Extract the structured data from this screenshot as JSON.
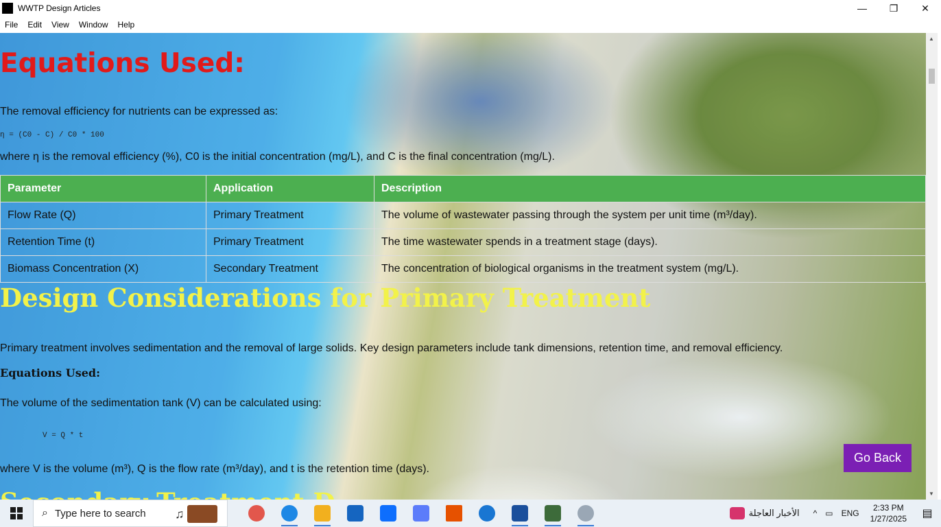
{
  "window": {
    "title": "WWTP Design Articles",
    "controls": {
      "minimize": "—",
      "maximize": "❐",
      "close": "✕"
    }
  },
  "menu": [
    "File",
    "Edit",
    "View",
    "Window",
    "Help"
  ],
  "article": {
    "equations_heading": "Equations Used:",
    "nutrient_intro": "The removal efficiency for nutrients can be expressed as:",
    "nutrient_equation": "η = (C0 - C) / C0 * 100",
    "nutrient_where": "where η is the removal efficiency (%), C0 is the initial concentration (mg/L), and C is the final concentration (mg/L).",
    "table": {
      "headers": [
        "Parameter",
        "Application",
        "Description"
      ],
      "rows": [
        [
          "Flow Rate (Q)",
          "Primary Treatment",
          "The volume of wastewater passing through the system per unit time (m³/day)."
        ],
        [
          "Retention Time (t)",
          "Primary Treatment",
          "The time wastewater spends in a treatment stage (days)."
        ],
        [
          "Biomass Concentration (X)",
          "Secondary Treatment",
          "The concentration of biological organisms in the treatment system (mg/L)."
        ]
      ]
    },
    "primary_heading": "Design Considerations for Primary Treatment",
    "primary_intro": "Primary treatment involves sedimentation and the removal of large solids. Key design parameters include tank dimensions, retention time, and removal efficiency.",
    "primary_eq_heading": "Equations Used:",
    "volume_intro": "The volume of the sedimentation tank (V) can be calculated using:",
    "volume_equation": "V = Q * t",
    "volume_where": "where V is the volume (m³), Q is the flow rate (m³/day), and t is the retention time (days).",
    "next_heading_partial": "Secondary Treatment D"
  },
  "go_back_label": "Go Back",
  "taskbar": {
    "search_placeholder": "Type here to search",
    "news_label": "الأخبار العاجلة",
    "language": "ENG",
    "time": "2:33 PM",
    "date": "1/27/2025",
    "app_colors": [
      "#e2574c",
      "#1e88e5",
      "#f2b01e",
      "#1565c0",
      "#0d6efd",
      "#5c7cfa",
      "#e65100",
      "#1976d2",
      "#1a4f9c",
      "#3d6b3a",
      "#9aa7b5"
    ]
  }
}
